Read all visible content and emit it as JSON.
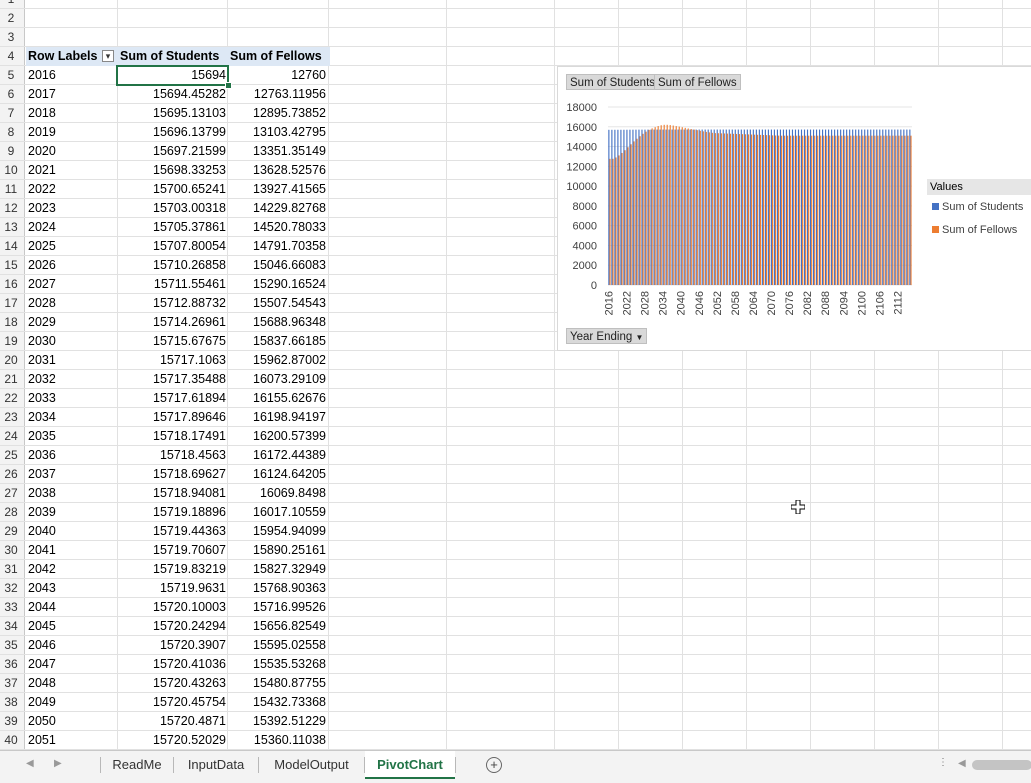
{
  "pivot": {
    "headers": [
      "Row Labels",
      "Sum of Students",
      "Sum of Fellows"
    ],
    "rows": [
      [
        "2016",
        "15694",
        "12760"
      ],
      [
        "2017",
        "15694.45282",
        "12763.11956"
      ],
      [
        "2018",
        "15695.13103",
        "12895.73852"
      ],
      [
        "2019",
        "15696.13799",
        "13103.42795"
      ],
      [
        "2020",
        "15697.21599",
        "13351.35149"
      ],
      [
        "2021",
        "15698.33253",
        "13628.52576"
      ],
      [
        "2022",
        "15700.65241",
        "13927.41565"
      ],
      [
        "2023",
        "15703.00318",
        "14229.82768"
      ],
      [
        "2024",
        "15705.37861",
        "14520.78033"
      ],
      [
        "2025",
        "15707.80054",
        "14791.70358"
      ],
      [
        "2026",
        "15710.26858",
        "15046.66083"
      ],
      [
        "2027",
        "15711.55461",
        "15290.16524"
      ],
      [
        "2028",
        "15712.88732",
        "15507.54543"
      ],
      [
        "2029",
        "15714.26961",
        "15688.96348"
      ],
      [
        "2030",
        "15715.67675",
        "15837.66185"
      ],
      [
        "2031",
        "15717.1063",
        "15962.87002"
      ],
      [
        "2032",
        "15717.35488",
        "16073.29109"
      ],
      [
        "2033",
        "15717.61894",
        "16155.62676"
      ],
      [
        "2034",
        "15717.89646",
        "16198.94197"
      ],
      [
        "2035",
        "15718.17491",
        "16200.57399"
      ],
      [
        "2036",
        "15718.4563",
        "16172.44389"
      ],
      [
        "2037",
        "15718.69627",
        "16124.64205"
      ],
      [
        "2038",
        "15718.94081",
        "16069.8498"
      ],
      [
        "2039",
        "15719.18896",
        "16017.10559"
      ],
      [
        "2040",
        "15719.44363",
        "15954.94099"
      ],
      [
        "2041",
        "15719.70607",
        "15890.25161"
      ],
      [
        "2042",
        "15719.83219",
        "15827.32949"
      ],
      [
        "2043",
        "15719.9631",
        "15768.90363"
      ],
      [
        "2044",
        "15720.10003",
        "15716.99526"
      ],
      [
        "2045",
        "15720.24294",
        "15656.82549"
      ],
      [
        "2046",
        "15720.3907",
        "15595.02558"
      ],
      [
        "2047",
        "15720.41036",
        "15535.53268"
      ],
      [
        "2048",
        "15720.43263",
        "15480.87755"
      ],
      [
        "2049",
        "15720.45754",
        "15432.73368"
      ],
      [
        "2050",
        "15720.4871",
        "15392.51229"
      ],
      [
        "2051",
        "15720.52029",
        "15360.11038"
      ]
    ]
  },
  "rownums": [
    "1",
    "2",
    "3",
    "4",
    "5",
    "6",
    "7",
    "8",
    "9",
    "10",
    "11",
    "12",
    "13",
    "14",
    "15",
    "16",
    "17",
    "18",
    "19",
    "20",
    "21",
    "22",
    "23",
    "24",
    "25",
    "26",
    "27",
    "28",
    "29",
    "30",
    "31",
    "32",
    "33",
    "34",
    "35",
    "36",
    "37",
    "38",
    "39",
    "40"
  ],
  "chart": {
    "field_buttons": [
      "Sum of Students",
      "Sum of Fellows"
    ],
    "axis_field": "Year Ending",
    "legend_title": "Values"
  },
  "chart_data": {
    "type": "bar",
    "x_start": 2016,
    "x_end": 2116,
    "x_ticks": [
      "2016",
      "2022",
      "2028",
      "2034",
      "2040",
      "2046",
      "2052",
      "2058",
      "2064",
      "2070",
      "2076",
      "2082",
      "2088",
      "2094",
      "2100",
      "2106",
      "2112"
    ],
    "y_ticks": [
      "18000",
      "16000",
      "14000",
      "12000",
      "10000",
      "8000",
      "6000",
      "4000",
      "2000",
      "0"
    ],
    "ylim": [
      0,
      18000
    ],
    "series": [
      {
        "name": "Sum of Students",
        "color": "#4472c4"
      },
      {
        "name": "Sum of Fellows",
        "color": "#ed7d31"
      }
    ]
  },
  "tabs": [
    "ReadMe",
    "InputData",
    "ModelOutput",
    "PivotChart"
  ],
  "active_tab": "PivotChart"
}
